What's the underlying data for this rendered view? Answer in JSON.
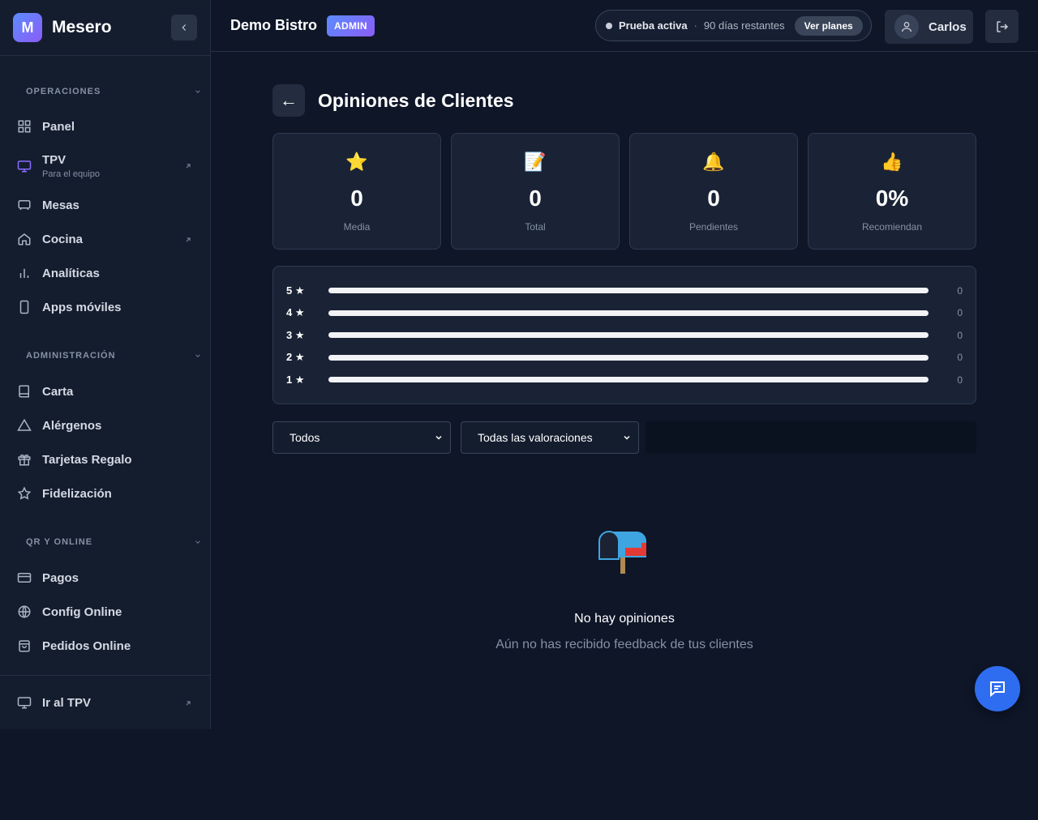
{
  "brand": {
    "logo_letter": "M",
    "name": "Mesero"
  },
  "sidebar": {
    "sections": [
      {
        "title": "OPERACIONES",
        "items": [
          {
            "label": "Panel",
            "icon": "grid-icon"
          },
          {
            "label": "TPV",
            "sublabel": "Para el equipo",
            "icon": "monitor-icon",
            "external": true
          },
          {
            "label": "Mesas",
            "icon": "table-icon"
          },
          {
            "label": "Cocina",
            "icon": "home-icon",
            "external": true
          },
          {
            "label": "Analíticas",
            "icon": "bar-chart-icon"
          },
          {
            "label": "Apps móviles",
            "icon": "smartphone-icon"
          }
        ]
      },
      {
        "title": "ADMINISTRACIÓN",
        "items": [
          {
            "label": "Carta",
            "icon": "book-icon"
          },
          {
            "label": "Alérgenos",
            "icon": "warning-icon"
          },
          {
            "label": "Tarjetas Regalo",
            "icon": "gift-icon"
          },
          {
            "label": "Fidelización",
            "icon": "star-icon"
          }
        ]
      },
      {
        "title": "QR Y ONLINE",
        "items": [
          {
            "label": "Pagos",
            "icon": "credit-card-icon"
          },
          {
            "label": "Config Online",
            "icon": "globe-icon"
          },
          {
            "label": "Pedidos Online",
            "icon": "shopping-bag-icon"
          }
        ]
      }
    ],
    "bottom_item": {
      "label": "Ir al TPV",
      "icon": "monitor-icon"
    }
  },
  "header": {
    "restaurant": "Demo Bistro",
    "role_badge": "ADMIN",
    "trial": {
      "status": "Prueba activa",
      "separator": "·",
      "days": "90 días restantes",
      "plans_button": "Ver planes"
    },
    "user_name": "Carlos"
  },
  "page": {
    "back_label": "←",
    "title": "Opiniones de Clientes",
    "stats": [
      {
        "icon": "⭐",
        "value": "0",
        "label": "Media"
      },
      {
        "icon": "📝",
        "value": "0",
        "label": "Total"
      },
      {
        "icon": "🔔",
        "value": "0",
        "label": "Pendientes"
      },
      {
        "icon": "👍",
        "value": "0%",
        "label": "Recomiendan"
      }
    ],
    "distribution": [
      {
        "label": "5 ★",
        "count": "0",
        "fraction": 0
      },
      {
        "label": "4 ★",
        "count": "0",
        "fraction": 0
      },
      {
        "label": "3 ★",
        "count": "0",
        "fraction": 0
      },
      {
        "label": "2 ★",
        "count": "0",
        "fraction": 0
      },
      {
        "label": "1 ★",
        "count": "0",
        "fraction": 0
      }
    ],
    "filters": {
      "status": "Todos",
      "rating": "Todas las valoraciones"
    },
    "empty": {
      "icon": "mailbox-icon",
      "title": "No hay opiniones",
      "subtitle": "Aún no has recibido feedback de tus clientes"
    }
  },
  "colors": {
    "accent": "#2f6df0",
    "brand_gradient_start": "#5b8cff",
    "brand_gradient_end": "#8a5cf6",
    "star": "#f5b301"
  }
}
